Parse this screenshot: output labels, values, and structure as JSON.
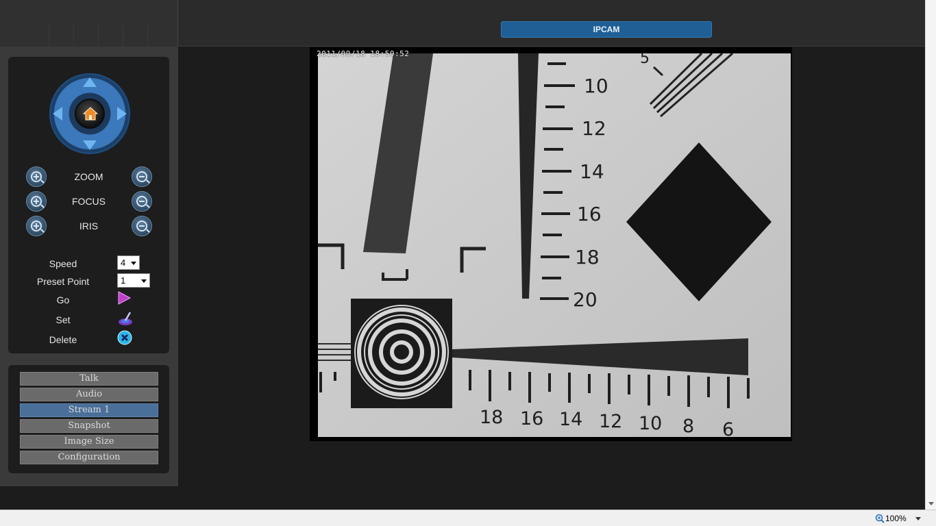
{
  "header": {
    "title": "IPCAM"
  },
  "ptz": {
    "controls": [
      {
        "label": "ZOOM"
      },
      {
        "label": "FOCUS"
      },
      {
        "label": "IRIS"
      }
    ],
    "speed_label": "Speed",
    "speed_value": "4",
    "preset_label": "Preset Point",
    "preset_value": "1",
    "go_label": "Go",
    "set_label": "Set",
    "delete_label": "Delete"
  },
  "menu": {
    "items": [
      {
        "label": "Talk"
      },
      {
        "label": "Audio"
      },
      {
        "label": "Stream 1",
        "active": true
      },
      {
        "label": "Snapshot"
      },
      {
        "label": "Image Size"
      },
      {
        "label": "Configuration"
      }
    ]
  },
  "video": {
    "timestamp": "2011/09/18  18:59:52",
    "ruler_vertical": [
      "10",
      "12",
      "14",
      "16",
      "18",
      "20"
    ],
    "ruler_horizontal": [
      "18",
      "16",
      "14",
      "12",
      "10",
      "8",
      "6"
    ],
    "corner_number": "5"
  },
  "statusbar": {
    "zoom": "100%"
  },
  "colors": {
    "accent": "#1f5f96",
    "menu_active": "#4a6f99",
    "dpad": "#3b79bc"
  }
}
